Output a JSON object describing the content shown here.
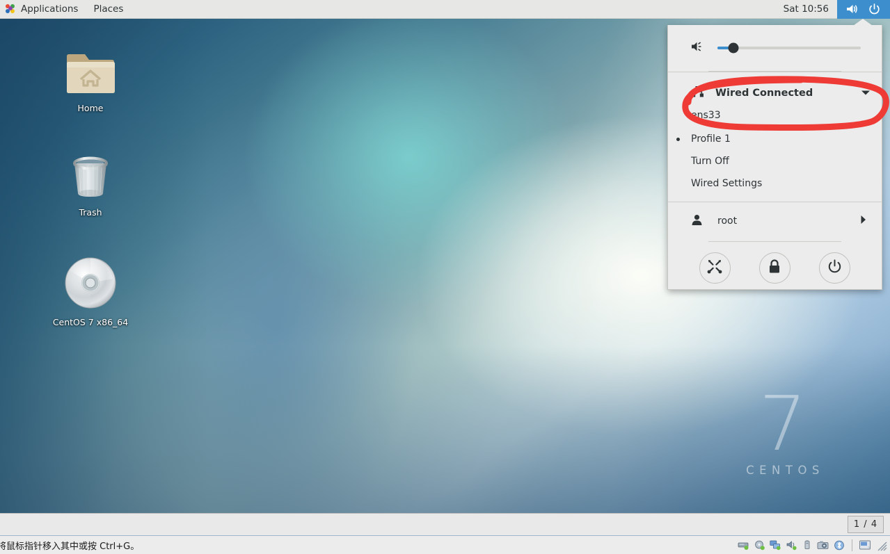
{
  "topbar": {
    "apps_icon": "applications-grid-icon",
    "applications_label": "Applications",
    "places_label": "Places",
    "clock": "Sat 10:56",
    "volume_icon": "volume-high-icon",
    "power_icon": "power-icon"
  },
  "desktop": {
    "icons": [
      {
        "name": "home-folder",
        "icon": "folder-home-icon",
        "label": "Home"
      },
      {
        "name": "trash",
        "icon": "trash-bin-icon",
        "label": "Trash"
      },
      {
        "name": "cdrom",
        "icon": "optical-disc-icon",
        "label": "CentOS 7 x86_64"
      }
    ],
    "watermark_number": "7",
    "watermark_name": "CENTOS"
  },
  "system_menu": {
    "volume": {
      "icon": "volume-medium-icon",
      "level_percent": 11
    },
    "network": {
      "icon": "wired-network-icon",
      "title": "Wired Connected",
      "chevron": "chevron-down-icon",
      "device": "ens33",
      "items": [
        {
          "name": "profile-1",
          "label": "Profile 1",
          "selected": true
        },
        {
          "name": "turn-off",
          "label": "Turn Off",
          "selected": false
        },
        {
          "name": "wired-settings",
          "label": "Wired Settings",
          "selected": false
        }
      ]
    },
    "user": {
      "icon": "user-avatar-icon",
      "name": "root",
      "expander": "chevron-right-icon"
    },
    "actions": [
      {
        "name": "settings-button",
        "icon": "tools-icon"
      },
      {
        "name": "lock-button",
        "icon": "lock-icon"
      },
      {
        "name": "power-button",
        "icon": "power-icon"
      }
    ]
  },
  "annotation": {
    "name": "red-ellipse-highlight",
    "color": "#ef3b36"
  },
  "vmware": {
    "workspace_indicator": "1 / 4",
    "status_text": "将鼠标指针移入其中或按 Ctrl+G。",
    "tray_icons": [
      {
        "name": "hard-disk-icon"
      },
      {
        "name": "cd-dvd-icon"
      },
      {
        "name": "network-adapter-icon"
      },
      {
        "name": "sound-card-icon"
      },
      {
        "name": "usb-device-icon"
      },
      {
        "name": "camera-icon"
      },
      {
        "name": "bluetooth-icon"
      },
      {
        "name": "display-icon"
      }
    ],
    "resize_grip": "resize-grip-icon"
  },
  "colors": {
    "accent_blue": "#3c8ecc",
    "annotation_red": "#ef3b36",
    "panel_bg": "#ececec",
    "topbar_bg": "#e7e7e5"
  }
}
